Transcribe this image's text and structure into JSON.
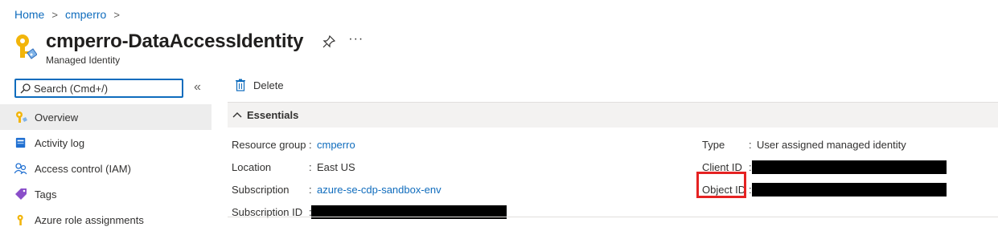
{
  "breadcrumb": {
    "home": "Home",
    "resource_group": "cmperro"
  },
  "header": {
    "title": "cmperro-DataAccessIdentity",
    "subtitle": "Managed Identity",
    "more": "···"
  },
  "search": {
    "placeholder": "Search (Cmd+/)"
  },
  "collapse_label": "«",
  "nav": {
    "items": [
      {
        "label": "Overview",
        "icon": "key-icon",
        "active": true
      },
      {
        "label": "Activity log",
        "icon": "activity-log-icon"
      },
      {
        "label": "Access control (IAM)",
        "icon": "people-icon"
      },
      {
        "label": "Tags",
        "icon": "tag-icon"
      },
      {
        "label": "Azure role assignments",
        "icon": "key-icon"
      }
    ]
  },
  "toolbar": {
    "delete_label": "Delete"
  },
  "essentials": {
    "title": "Essentials",
    "left": [
      {
        "label": "Resource group",
        "value": "cmperro",
        "link": true
      },
      {
        "label": "Location",
        "value": "East US",
        "link": false
      },
      {
        "label": "Subscription",
        "value": "azure-se-cdp-sandbox-env",
        "link": true
      },
      {
        "label": "Subscription ID",
        "value": "",
        "redacted": true
      }
    ],
    "right": [
      {
        "label": "Type",
        "value": "User assigned managed identity"
      },
      {
        "label": "Client ID",
        "value": "",
        "redacted": true
      },
      {
        "label": "Object ID",
        "value": "",
        "redacted": true
      }
    ]
  },
  "colors": {
    "accent": "#0f6cbd",
    "highlight": "#e52222",
    "redaction": "#000000"
  }
}
